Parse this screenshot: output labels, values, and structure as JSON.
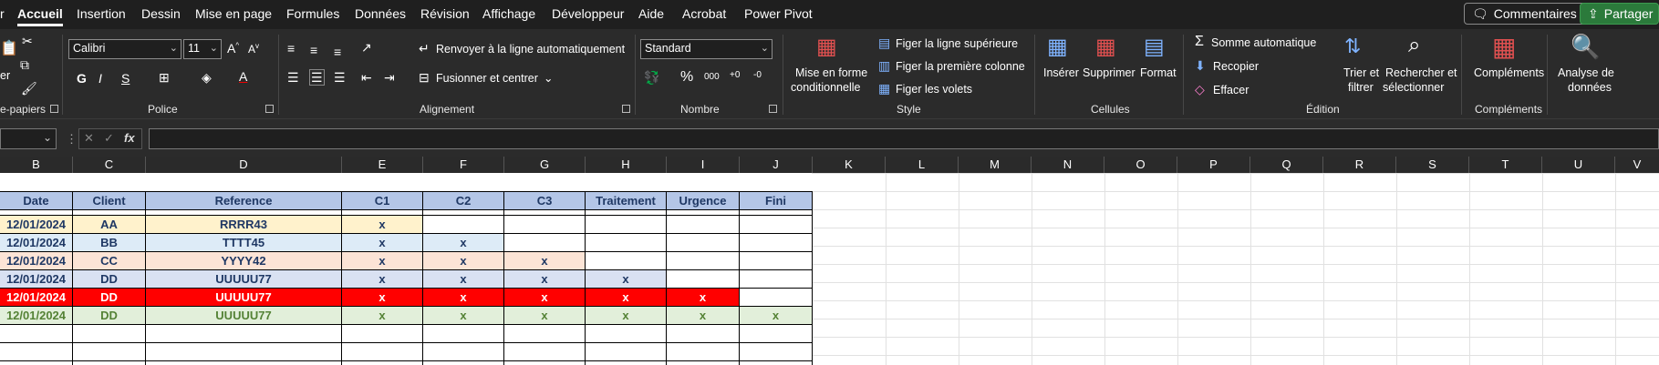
{
  "tabs": [
    "r",
    "Accueil",
    "Insertion",
    "Dessin",
    "Mise en page",
    "Formules",
    "Données",
    "Révision",
    "Affichage",
    "Développeur",
    "Aide",
    "Acrobat",
    "Power Pivot"
  ],
  "topbuttons": {
    "comments": "Commentaires",
    "share": "Partager"
  },
  "ribbon": {
    "clipboard": {
      "paste_partial": "er",
      "label": "e-papiers"
    },
    "font": {
      "name": "Calibri",
      "size": "11",
      "label": "Police"
    },
    "alignment": {
      "wrap": "Renvoyer à la ligne automatiquement",
      "merge": "Fusionner et centrer",
      "label": "Alignement"
    },
    "number": {
      "format": "Standard",
      "label": "Nombre"
    },
    "style": {
      "conditional_1": "Mise en forme",
      "conditional_2": "conditionnelle",
      "freeze_top": "Figer la ligne supérieure",
      "freeze_first": "Figer la première colonne",
      "freeze_panes": "Figer les volets",
      "label": "Style"
    },
    "cells": {
      "insert": "Insérer",
      "delete": "Supprimer",
      "format": "Format",
      "label": "Cellules"
    },
    "editing": {
      "autosum": "Somme automatique",
      "fill": "Recopier",
      "clear": "Effacer",
      "sort_1": "Trier et",
      "sort_2": "filtrer",
      "find_1": "Rechercher et",
      "find_2": "sélectionner",
      "label": "Édition"
    },
    "addins": {
      "label_btn": "Compléments",
      "label": "Compléments"
    },
    "analysis": {
      "l1": "Analyse de",
      "l2": "données"
    }
  },
  "formulabar": {
    "fx": "fx",
    "value": ""
  },
  "columns": [
    "B",
    "C",
    "D",
    "E",
    "F",
    "G",
    "H",
    "I",
    "J",
    "K",
    "L",
    "M",
    "N",
    "O",
    "P",
    "Q",
    "R",
    "S",
    "T",
    "U",
    "V"
  ],
  "table": {
    "headers": [
      "Date",
      "Client",
      "Reference",
      "C1",
      "C2",
      "C3",
      "Traitement",
      "Urgence",
      "Fini"
    ],
    "rows": [
      {
        "bg": "#fff2cc",
        "fg": "#1f3864",
        "cells": [
          "12/01/2024",
          "AA",
          "RRRR43",
          "x",
          "",
          "",
          "",
          "",
          ""
        ]
      },
      {
        "bg": "#ddebf7",
        "fg": "#1f3864",
        "cells": [
          "12/01/2024",
          "BB",
          "TTTT45",
          "x",
          "x",
          "",
          "",
          "",
          ""
        ]
      },
      {
        "bg": "#fce4d6",
        "fg": "#1f3864",
        "cells": [
          "12/01/2024",
          "CC",
          "YYYY42",
          "x",
          "x",
          "x",
          "",
          "",
          ""
        ]
      },
      {
        "bg": "#d9e1f2",
        "fg": "#1f3864",
        "cells": [
          "12/01/2024",
          "DD",
          "UUUUU77",
          "x",
          "x",
          "x",
          "x",
          "",
          ""
        ]
      },
      {
        "bg": "#ff0000",
        "fg": "#ffffff",
        "cells": [
          "12/01/2024",
          "DD",
          "UUUUU77",
          "x",
          "x",
          "x",
          "x",
          "x",
          ""
        ]
      },
      {
        "bg": "#e2efda",
        "fg": "#548235",
        "cells": [
          "12/01/2024",
          "DD",
          "UUUUU77",
          "x",
          "x",
          "x",
          "x",
          "x",
          "x"
        ]
      }
    ]
  },
  "colors": {
    "ribbon": "#2b2b2b",
    "tabbar": "#1f1f1f",
    "header_fill": "#b4c6e7",
    "header_text": "#1f3864",
    "share": "#2b7a3b"
  }
}
